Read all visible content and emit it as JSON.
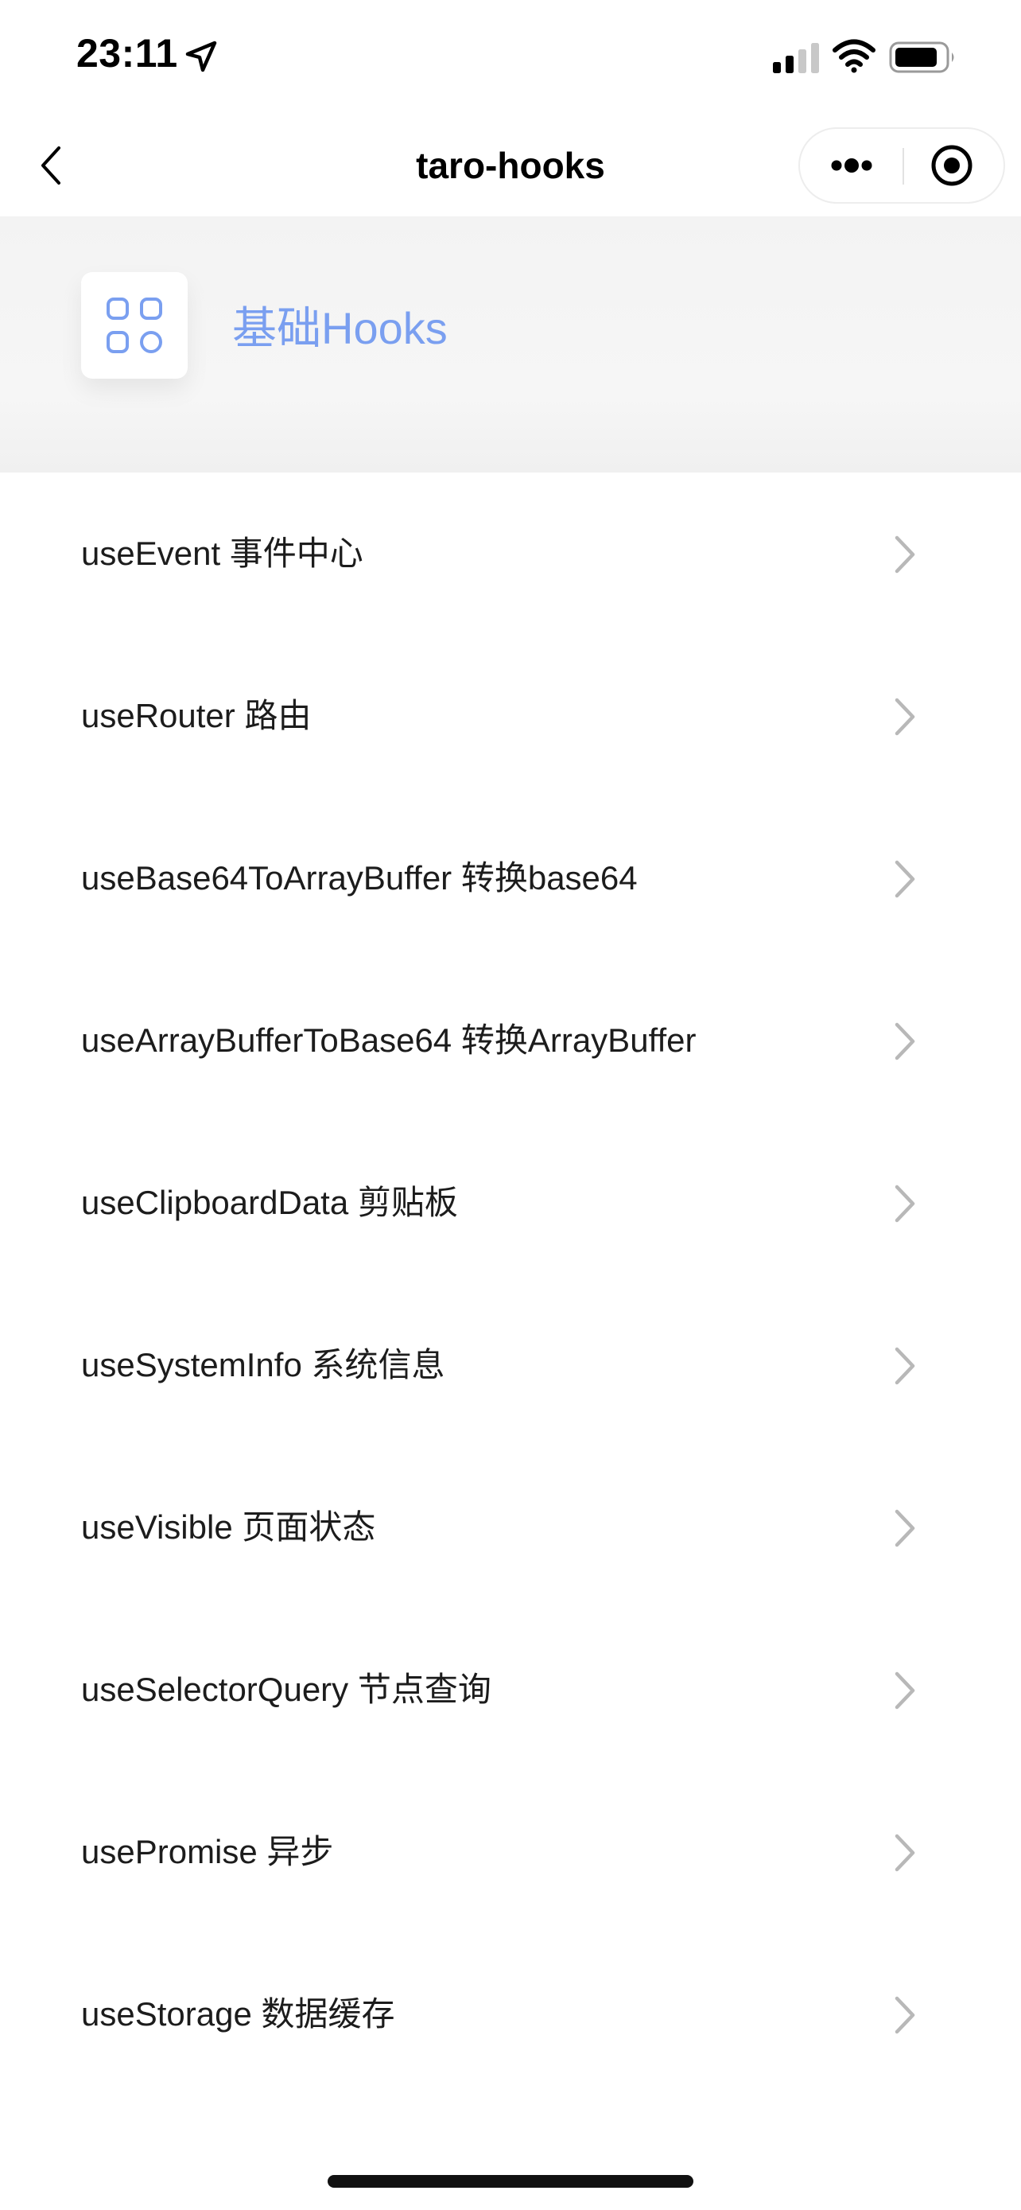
{
  "status_bar": {
    "time": "23:11"
  },
  "nav": {
    "title": "taro-hooks"
  },
  "header": {
    "title": "基础Hooks",
    "accent_color": "#7a9ff0"
  },
  "list": {
    "items": [
      {
        "label": "useEvent 事件中心"
      },
      {
        "label": "useRouter 路由"
      },
      {
        "label": "useBase64ToArrayBuffer 转换base64"
      },
      {
        "label": "useArrayBufferToBase64 转换ArrayBuffer"
      },
      {
        "label": "useClipboardData 剪贴板"
      },
      {
        "label": "useSystemInfo 系统信息"
      },
      {
        "label": "useVisible 页面状态"
      },
      {
        "label": "useSelectorQuery 节点查询"
      },
      {
        "label": "usePromise 异步"
      },
      {
        "label": "useStorage 数据缓存"
      }
    ]
  }
}
